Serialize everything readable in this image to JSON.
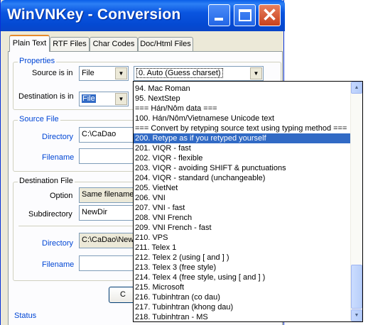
{
  "window": {
    "title": "WinVNKey - Conversion",
    "close_glyph": "✕"
  },
  "tabs": [
    {
      "label": "Plain Text",
      "active": true
    },
    {
      "label": "RTF Files",
      "active": false
    },
    {
      "label": "Char Codes",
      "active": false
    },
    {
      "label": "Doc/Html Files",
      "active": false
    }
  ],
  "properties": {
    "group_label": "Properties",
    "source_label": "Source is in",
    "source_value": "File",
    "charset_value": "0. Auto (Guess charset)",
    "destination_label": "Destination is in",
    "destination_value": "File"
  },
  "source_file": {
    "group_label": "Source File",
    "directory_label": "Directory",
    "directory_value": "C:\\CaDao",
    "filename_label": "Filename",
    "filename_value": ""
  },
  "destination_file": {
    "group_label": "Destination File",
    "option_label": "Option",
    "option_value": "Same filename,",
    "subdirectory_label": "Subdirectory",
    "subdirectory_value": "NewDir",
    "directory_label": "Directory",
    "directory_value": "C:\\CaDao\\New",
    "filename_label": "Filename",
    "filename_value": ""
  },
  "button_partial": "C",
  "status_label": "Status",
  "dropdown": {
    "items": [
      "94. Mac Roman",
      "95. NextStep",
      "=== Hán/Nôm data ===",
      "100. Hán/Nôm/Vietnamese Unicode text",
      "=== Convert by retyping source text using typing method ===",
      "200. Retype as if you retyped yourself",
      "201. VIQR - fast",
      "202. VIQR - flexible",
      "203. VIQR - avoiding SHIFT & punctuations",
      "204. VIQR - standard (unchangeable)",
      "205. VietNet",
      "206. VNI",
      "207. VNI - fast",
      "208. VNI French",
      "209. VNI French - fast",
      "210. VPS",
      "211. Telex 1",
      "212. Telex 2 (using [ and ] )",
      "213. Telex 3 (free style)",
      "214. Telex 4 (free style, using [ and ] )",
      "215. Microsoft",
      "216. Tubinhtran (co dau)",
      "217. Tubinhtran (khong dau)",
      "218. Tubinhtran - MS"
    ],
    "selected_index": 5,
    "scroll_up_glyph": "▲",
    "scroll_down_glyph": "▼"
  },
  "combo_arrow_glyph": "▼"
}
